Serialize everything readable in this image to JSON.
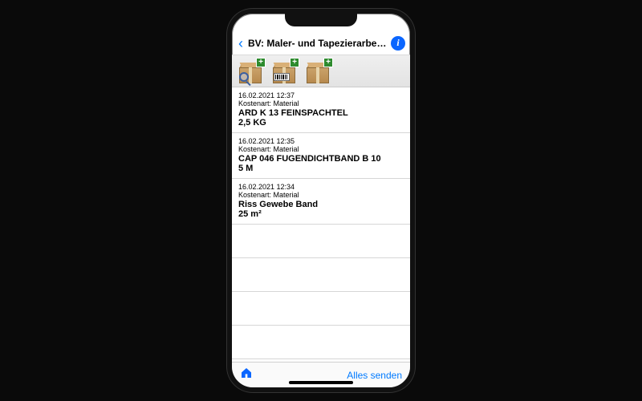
{
  "nav": {
    "title": "BV: Maler- und Tapezierarbeite...",
    "info_glyph": "i"
  },
  "actions": {
    "search_label": "box-search",
    "barcode_label": "box-barcode",
    "add_label": "box-add"
  },
  "kostenart_prefix": "Kostenart: ",
  "items": [
    {
      "timestamp": "16.02.2021 12:37",
      "kostenart": "Material",
      "name": "ARD K 13 FEINSPACHTEL",
      "qty": "2,5 KG"
    },
    {
      "timestamp": "16.02.2021 12:35",
      "kostenart": "Material",
      "name": "CAP 046 FUGENDICHTBAND B 10",
      "qty": "5 M"
    },
    {
      "timestamp": "16.02.2021 12:34",
      "kostenart": "Material",
      "name": "Riss Gewebe Band",
      "qty": "25 m²"
    }
  ],
  "toolbar": {
    "home_glyph": "⌂",
    "send_all": "Alles senden"
  }
}
